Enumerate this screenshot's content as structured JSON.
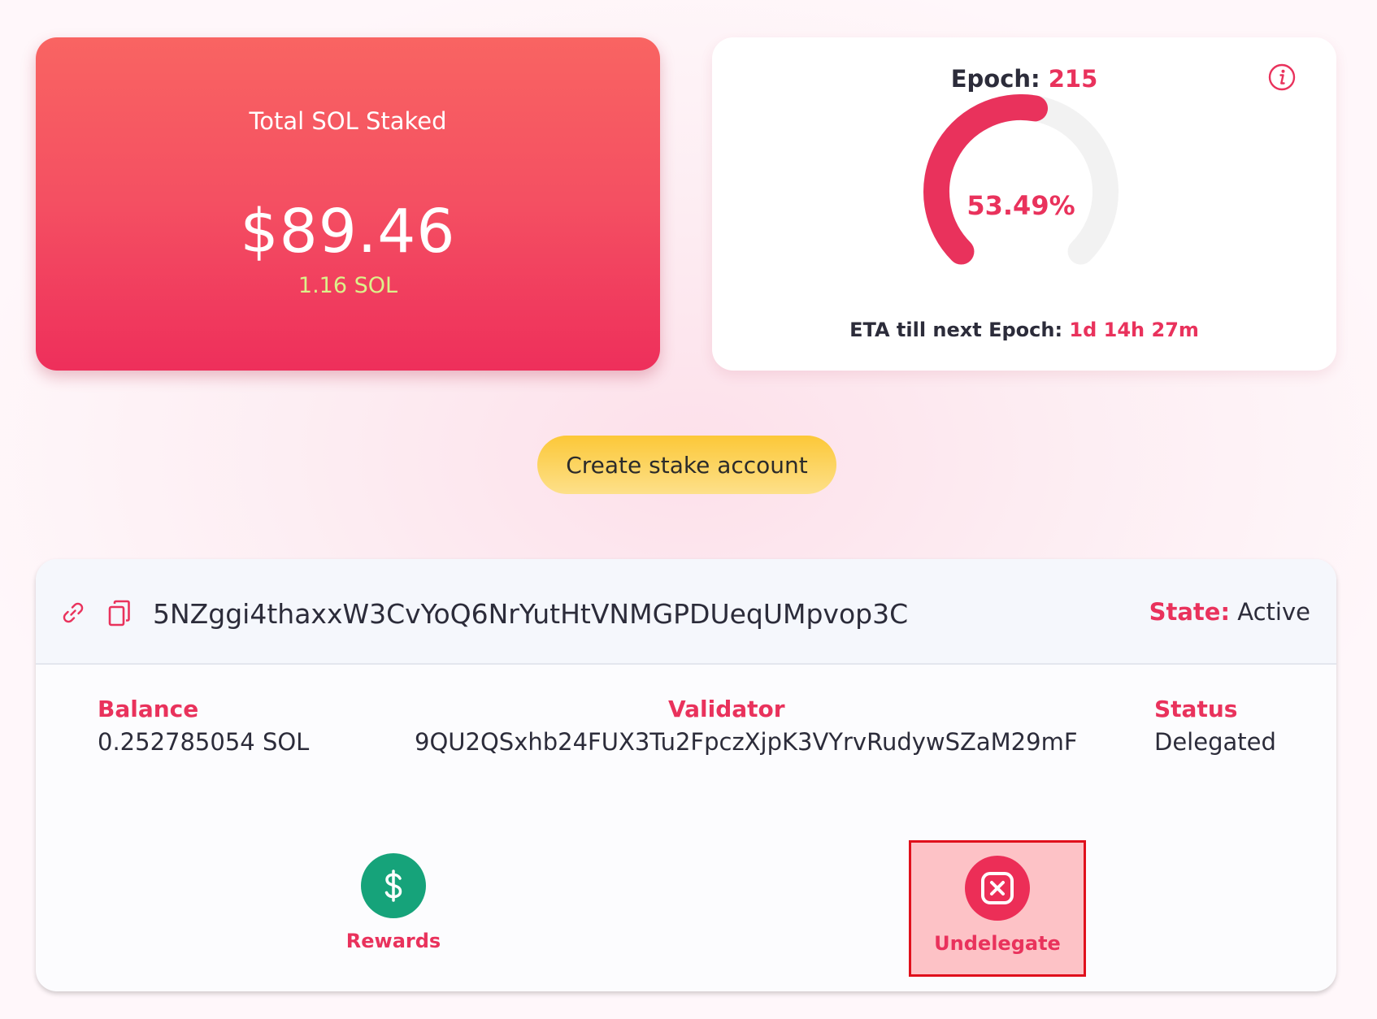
{
  "total_card": {
    "title": "Total SOL Staked",
    "usd_value": "$89.46",
    "sol_value": "1.16 SOL"
  },
  "epoch_card": {
    "label": "Epoch:",
    "number": "215",
    "progress_text": "53.49%",
    "progress_percent": 53.49,
    "eta_label": "ETA till next Epoch:",
    "eta_value": "1d 14h 27m",
    "info_icon": "info-icon"
  },
  "create_button": {
    "label": "Create stake account"
  },
  "stake_account": {
    "address": "5NZggi4thaxxW3CvYoQ6NrYutHtVNMGPDUeqUMpvop3C",
    "state_label": "State:",
    "state_value": "Active",
    "icons": [
      "link-icon",
      "copy-icon"
    ],
    "balance_label": "Balance",
    "balance_value": "0.252785054 SOL",
    "validator_label": "Validator",
    "validator_value": "9QU2QSxhb24FUX3Tu2FpczXjpK3VYrvRudywSZaM29mF",
    "status_label": "Status",
    "status_value": "Delegated",
    "actions": {
      "rewards_label": "Rewards",
      "rewards_icon": "dollar-icon",
      "undelegate_label": "Undelegate",
      "undelegate_icon": "close-square-icon"
    }
  },
  "colors": {
    "accent": "#e9325c",
    "card_gradient_top": "#f96462",
    "card_gradient_bottom": "#ee2f5b",
    "sol_text": "#dcf18a",
    "button_yellow": "#fcc838",
    "rewards_green": "#16a37a",
    "gauge_track": "#f2f2f2"
  }
}
